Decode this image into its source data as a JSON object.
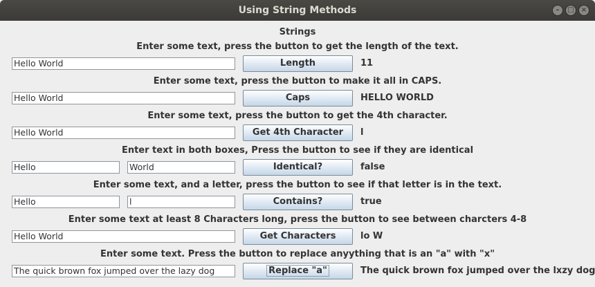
{
  "window": {
    "title": "Using String Methods"
  },
  "header": "Strings",
  "sections": [
    {
      "instruction": "Enter some text, press the button to get the length of the text.",
      "input": "Hello World",
      "button": "Length",
      "result": "11"
    },
    {
      "instruction": "Enter some text, press the button to make it all in CAPS.",
      "input": "Hello World",
      "button": "Caps",
      "result": "HELLO WORLD"
    },
    {
      "instruction": "Enter some text, press the button to get the 4th character.",
      "input": "Hello World",
      "button": "Get 4th Character",
      "result": "l"
    },
    {
      "instruction": "Enter text in both boxes, Press the button to see if they are identical",
      "input1": "Hello",
      "input2": "World",
      "button": "Identical?",
      "result": "false"
    },
    {
      "instruction": "Enter some text, and a letter, press the button to see if that letter is in the text.",
      "input1": "Hello",
      "input2": "l",
      "button": "Contains?",
      "result": "true"
    },
    {
      "instruction": "Enter some text at least 8 Characters long, press the button to see between charcters 4-8",
      "input": "Hello World",
      "button": "Get Characters",
      "result": "lo W"
    },
    {
      "instruction": "Enter some text. Press the button to replace anyything that is an \"a\" with \"x\"",
      "input": "The quick brown fox jumped over the lazy dog",
      "button": "Replace \"a\"",
      "result": "The quick brown fox jumped over the lxzy dog"
    }
  ]
}
